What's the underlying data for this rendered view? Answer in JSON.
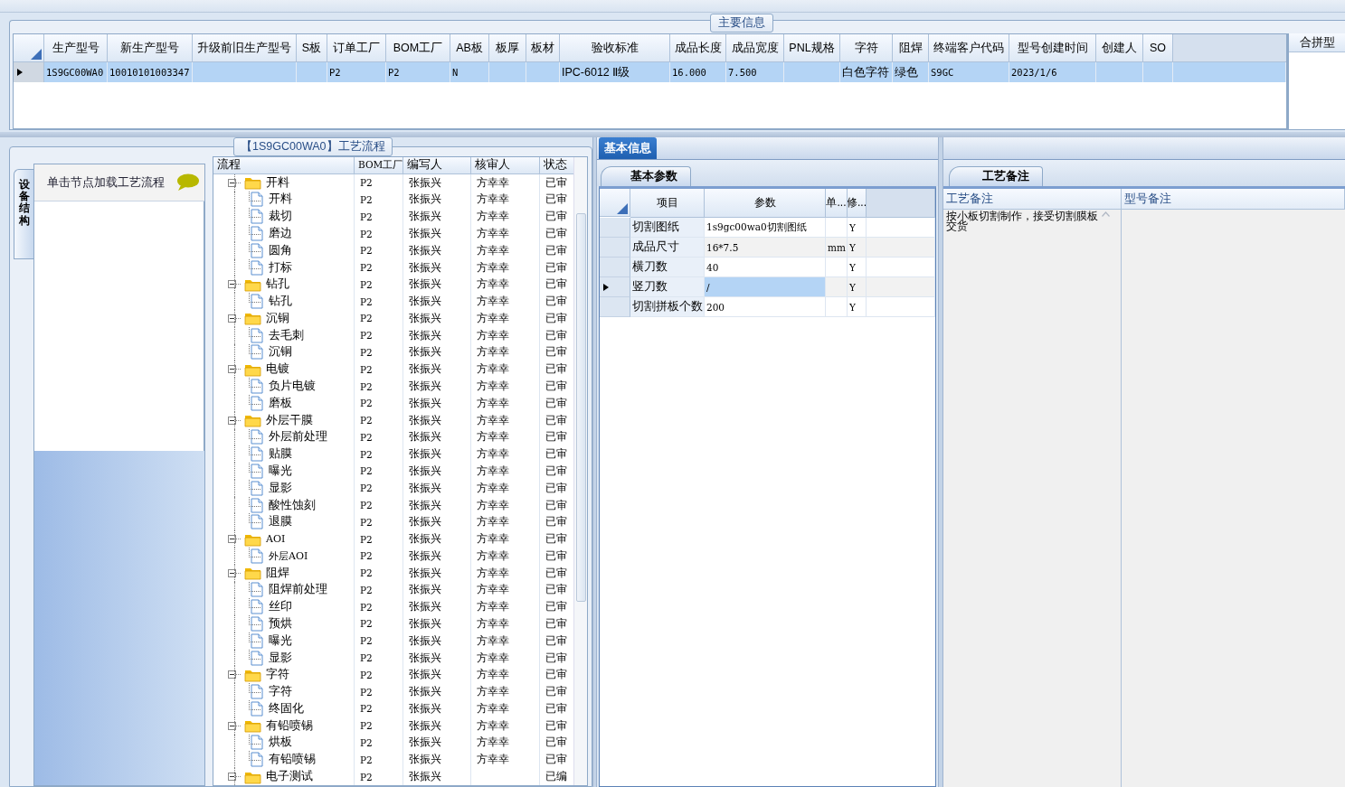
{
  "main_info": {
    "title": "主要信息",
    "columns": [
      "生产型号",
      "新生产型号",
      "升级前旧生产型号",
      "S板",
      "订单工厂",
      "BOM工厂",
      "AB板",
      "板厚",
      "板材",
      "验收标准",
      "成品长度",
      "成品宽度",
      "PNL规格",
      "字符",
      "阻焊",
      "终端客户代码",
      "型号创建时间",
      "创建人",
      "SO"
    ],
    "rows": [
      {
        "selected": true,
        "cells": [
          "1S9GC00WA0",
          "10010101003347",
          "",
          "",
          "P2",
          "P2",
          "N",
          "",
          "",
          "IPC-6012 Ⅱ级",
          "16.000",
          "7.500",
          "",
          "白色字符",
          "绿色",
          "S9GC",
          "2023/1/6",
          "",
          ""
        ]
      }
    ],
    "side_column": "合拼型"
  },
  "process": {
    "title": "【1S9GC00WA0】工艺流程",
    "side_tab": "设备结构",
    "hint": "单击节点加载工艺流程",
    "columns": [
      "流程",
      "BOM工厂",
      "编写人",
      "核审人",
      "状态"
    ],
    "tree": [
      {
        "name": "开料",
        "bom": "P2",
        "writer": "张振兴",
        "reviewer": "方幸幸",
        "status": "已审",
        "expanded": true,
        "children": [
          {
            "name": "开料",
            "bom": "P2",
            "writer": "张振兴",
            "reviewer": "方幸幸",
            "status": "已审"
          },
          {
            "name": "裁切",
            "bom": "P2",
            "writer": "张振兴",
            "reviewer": "方幸幸",
            "status": "已审"
          },
          {
            "name": "磨边",
            "bom": "P2",
            "writer": "张振兴",
            "reviewer": "方幸幸",
            "status": "已审"
          },
          {
            "name": "圆角",
            "bom": "P2",
            "writer": "张振兴",
            "reviewer": "方幸幸",
            "status": "已审"
          },
          {
            "name": "打标",
            "bom": "P2",
            "writer": "张振兴",
            "reviewer": "方幸幸",
            "status": "已审"
          }
        ]
      },
      {
        "name": "钻孔",
        "bom": "P2",
        "writer": "张振兴",
        "reviewer": "方幸幸",
        "status": "已审",
        "expanded": true,
        "children": [
          {
            "name": "钻孔",
            "bom": "P2",
            "writer": "张振兴",
            "reviewer": "方幸幸",
            "status": "已审"
          }
        ]
      },
      {
        "name": "沉铜",
        "bom": "P2",
        "writer": "张振兴",
        "reviewer": "方幸幸",
        "status": "已审",
        "expanded": true,
        "children": [
          {
            "name": "去毛刺",
            "bom": "P2",
            "writer": "张振兴",
            "reviewer": "方幸幸",
            "status": "已审"
          },
          {
            "name": "沉铜",
            "bom": "P2",
            "writer": "张振兴",
            "reviewer": "方幸幸",
            "status": "已审"
          }
        ]
      },
      {
        "name": "电镀",
        "bom": "P2",
        "writer": "张振兴",
        "reviewer": "方幸幸",
        "status": "已审",
        "expanded": true,
        "children": [
          {
            "name": "负片电镀",
            "bom": "P2",
            "writer": "张振兴",
            "reviewer": "方幸幸",
            "status": "已审"
          },
          {
            "name": "磨板",
            "bom": "P2",
            "writer": "张振兴",
            "reviewer": "方幸幸",
            "status": "已审"
          }
        ]
      },
      {
        "name": "外层干膜",
        "bom": "P2",
        "writer": "张振兴",
        "reviewer": "方幸幸",
        "status": "已审",
        "expanded": true,
        "children": [
          {
            "name": "外层前处理",
            "bom": "P2",
            "writer": "张振兴",
            "reviewer": "方幸幸",
            "status": "已审"
          },
          {
            "name": "贴膜",
            "bom": "P2",
            "writer": "张振兴",
            "reviewer": "方幸幸",
            "status": "已审"
          },
          {
            "name": "曝光",
            "bom": "P2",
            "writer": "张振兴",
            "reviewer": "方幸幸",
            "status": "已审"
          },
          {
            "name": "显影",
            "bom": "P2",
            "writer": "张振兴",
            "reviewer": "方幸幸",
            "status": "已审"
          },
          {
            "name": "酸性蚀刻",
            "bom": "P2",
            "writer": "张振兴",
            "reviewer": "方幸幸",
            "status": "已审"
          },
          {
            "name": "退膜",
            "bom": "P2",
            "writer": "张振兴",
            "reviewer": "方幸幸",
            "status": "已审"
          }
        ]
      },
      {
        "name": "AOI",
        "bom": "P2",
        "writer": "张振兴",
        "reviewer": "方幸幸",
        "status": "已审",
        "expanded": true,
        "children": [
          {
            "name": "外层AOI",
            "bom": "P2",
            "writer": "张振兴",
            "reviewer": "方幸幸",
            "status": "已审"
          }
        ]
      },
      {
        "name": "阻焊",
        "bom": "P2",
        "writer": "张振兴",
        "reviewer": "方幸幸",
        "status": "已审",
        "expanded": true,
        "children": [
          {
            "name": "阻焊前处理",
            "bom": "P2",
            "writer": "张振兴",
            "reviewer": "方幸幸",
            "status": "已审"
          },
          {
            "name": "丝印",
            "bom": "P2",
            "writer": "张振兴",
            "reviewer": "方幸幸",
            "status": "已审"
          },
          {
            "name": "预烘",
            "bom": "P2",
            "writer": "张振兴",
            "reviewer": "方幸幸",
            "status": "已审"
          },
          {
            "name": "曝光",
            "bom": "P2",
            "writer": "张振兴",
            "reviewer": "方幸幸",
            "status": "已审"
          },
          {
            "name": "显影",
            "bom": "P2",
            "writer": "张振兴",
            "reviewer": "方幸幸",
            "status": "已审"
          }
        ]
      },
      {
        "name": "字符",
        "bom": "P2",
        "writer": "张振兴",
        "reviewer": "方幸幸",
        "status": "已审",
        "expanded": true,
        "children": [
          {
            "name": "字符",
            "bom": "P2",
            "writer": "张振兴",
            "reviewer": "方幸幸",
            "status": "已审"
          },
          {
            "name": "终固化",
            "bom": "P2",
            "writer": "张振兴",
            "reviewer": "方幸幸",
            "status": "已审"
          }
        ]
      },
      {
        "name": "有铅喷锡",
        "bom": "P2",
        "writer": "张振兴",
        "reviewer": "方幸幸",
        "status": "已审",
        "expanded": true,
        "children": [
          {
            "name": "烘板",
            "bom": "P2",
            "writer": "张振兴",
            "reviewer": "方幸幸",
            "status": "已审"
          },
          {
            "name": "有铅喷锡",
            "bom": "P2",
            "writer": "张振兴",
            "reviewer": "方幸幸",
            "status": "已审"
          }
        ]
      },
      {
        "name": "电子测试",
        "bom": "P2",
        "writer": "张振兴",
        "status": "已编",
        "expanded": true
      }
    ]
  },
  "basic_info": {
    "tab": "基本信息",
    "subtab": "基本参数",
    "columns": [
      "项目",
      "参数",
      "单...",
      "修..."
    ],
    "rows": [
      {
        "item": "切割图纸",
        "value": "1s9gc00wa0切割图纸",
        "unit": "",
        "modified": "Y",
        "selected": false
      },
      {
        "item": "成品尺寸",
        "value": "16*7.5",
        "unit": "mm",
        "modified": "Y",
        "selected": false
      },
      {
        "item": "横刀数",
        "value": "40",
        "unit": "",
        "modified": "Y",
        "selected": false
      },
      {
        "item": "竖刀数",
        "value": "/",
        "unit": "",
        "modified": "Y",
        "selected": true
      },
      {
        "item": "切割拼板个数",
        "value": "200",
        "unit": "",
        "modified": "Y",
        "selected": false
      }
    ]
  },
  "notes": {
    "tab": "工艺备注",
    "columns": [
      "工艺备注",
      "型号备注"
    ],
    "process_note": "按小板切割制作，接受切割膜板交货"
  }
}
